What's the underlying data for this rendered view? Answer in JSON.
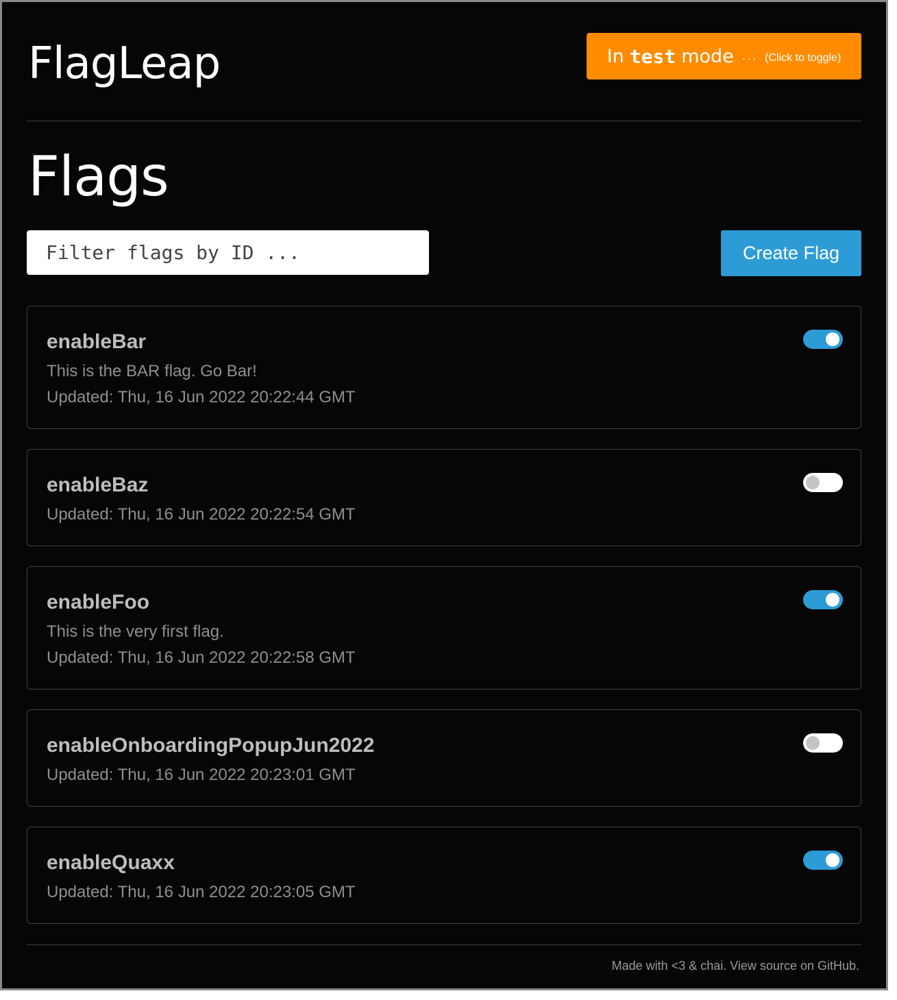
{
  "header": {
    "app_title": "FlagLeap",
    "mode_toggle": {
      "prefix": "In",
      "mode": "test",
      "suffix": "mode",
      "dots": "...",
      "hint": "(Click to toggle)",
      "color": "#ff8c00"
    }
  },
  "main": {
    "section_title": "Flags",
    "filter_placeholder": "Filter flags by ID ...",
    "create_button_label": "Create Flag",
    "accent_color": "#2d9cd6",
    "flags": [
      {
        "id": "enableBar",
        "description": "This is the BAR flag. Go Bar!",
        "updated": "Updated: Thu, 16 Jun 2022 20:22:44 GMT",
        "enabled": true
      },
      {
        "id": "enableBaz",
        "description": "",
        "updated": "Updated: Thu, 16 Jun 2022 20:22:54 GMT",
        "enabled": false
      },
      {
        "id": "enableFoo",
        "description": "This is the very first flag.",
        "updated": "Updated: Thu, 16 Jun 2022 20:22:58 GMT",
        "enabled": true
      },
      {
        "id": "enableOnboardingPopupJun2022",
        "description": "",
        "updated": "Updated: Thu, 16 Jun 2022 20:23:01 GMT",
        "enabled": false
      },
      {
        "id": "enableQuaxx",
        "description": "",
        "updated": "Updated: Thu, 16 Jun 2022 20:23:05 GMT",
        "enabled": true
      }
    ]
  },
  "footer": {
    "text": "Made with <3 & chai. View source on GitHub."
  }
}
